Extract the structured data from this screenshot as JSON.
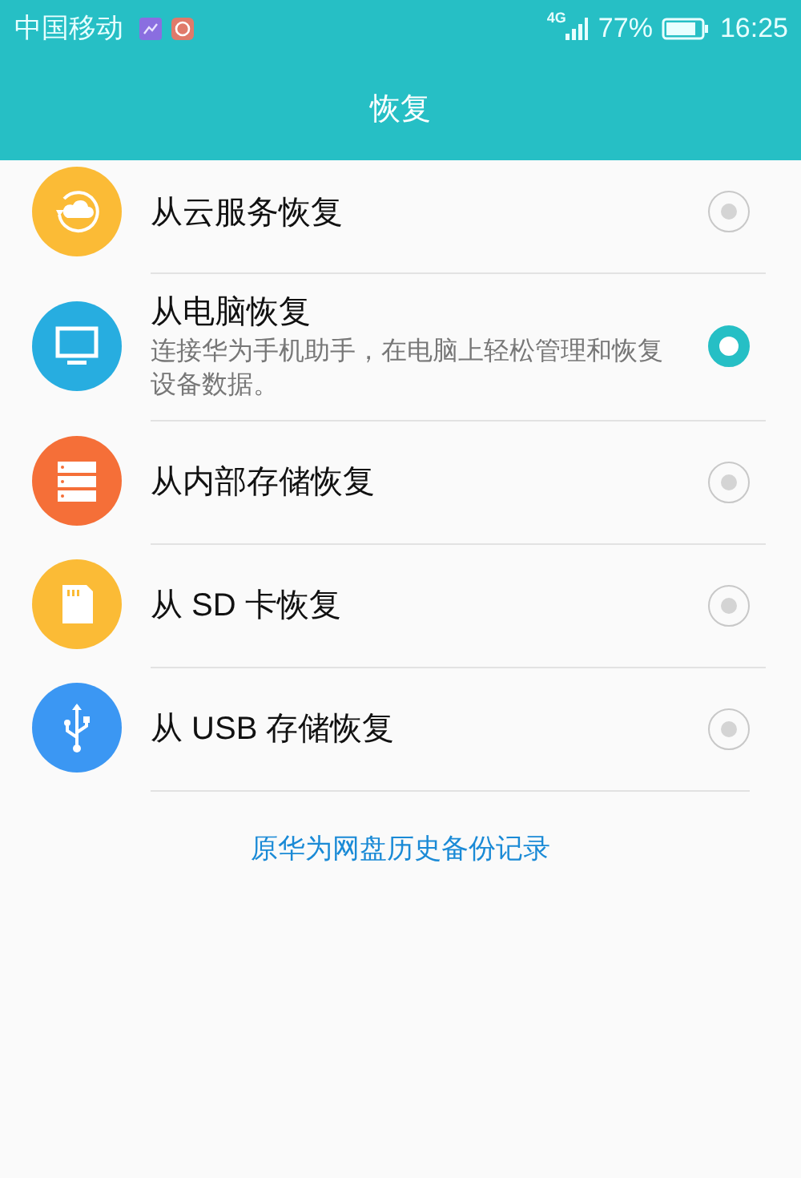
{
  "status_bar": {
    "carrier": "中国移动",
    "network": "4G",
    "battery_text": "77%",
    "time": "16:25"
  },
  "title": "恢复",
  "options": [
    {
      "kind": "cloud",
      "color": "#fbbb36",
      "label": "从云服务恢复",
      "selected": false
    },
    {
      "kind": "computer",
      "color": "#27ade0",
      "label": "从电脑恢复",
      "description": "连接华为手机助手，在电脑上轻松管理和恢复设备数据。",
      "selected": true
    },
    {
      "kind": "storage",
      "color": "#f56f38",
      "label": "从内部存储恢复",
      "selected": false
    },
    {
      "kind": "sd",
      "color": "#fbbb36",
      "label": "从 SD 卡恢复",
      "selected": false
    },
    {
      "kind": "usb",
      "color": "#3b97f3",
      "label": "从 USB 存储恢复",
      "selected": false
    }
  ],
  "link": "原华为网盘历史备份记录"
}
